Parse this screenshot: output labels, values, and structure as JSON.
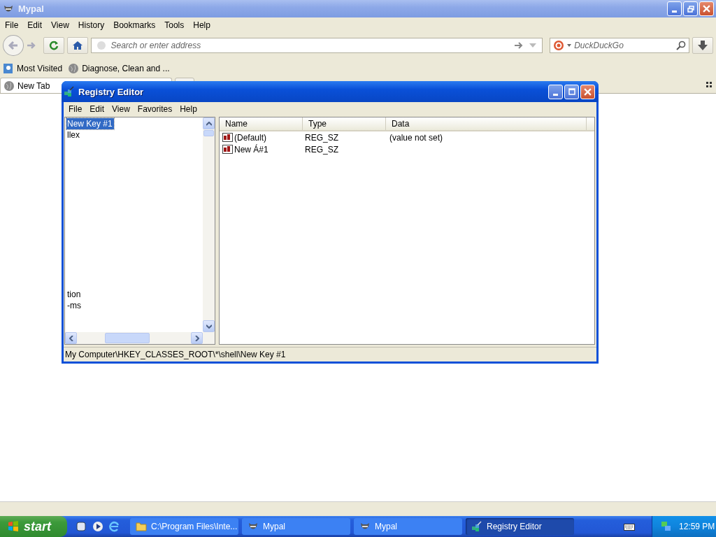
{
  "browser": {
    "title": "Mypal",
    "menu": [
      "File",
      "Edit",
      "View",
      "History",
      "Bookmarks",
      "Tools",
      "Help"
    ],
    "address": {
      "placeholder": "Search or enter address"
    },
    "search": {
      "placeholder": "DuckDuckGo"
    },
    "bookmarks": [
      {
        "label": "Most Visited",
        "kind": "folder"
      },
      {
        "label": "Diagnose, Clean and ...",
        "kind": "page"
      }
    ],
    "tabs": [
      {
        "label": "New Tab",
        "selected": true
      }
    ]
  },
  "registry_editor": {
    "title": "Registry Editor",
    "menu": [
      "File",
      "Edit",
      "View",
      "Favorites",
      "Help"
    ],
    "tree": {
      "items_top": [
        {
          "label": "New Key #1",
          "selected": true
        },
        {
          "label": "llex",
          "selected": false
        }
      ],
      "items_bottom": [
        {
          "label": "tion",
          "selected": false
        },
        {
          "label": "-ms",
          "selected": false
        }
      ]
    },
    "columns": [
      "Name",
      "Type",
      "Data"
    ],
    "values": [
      {
        "name": "(Default)",
        "type": "REG_SZ",
        "data": "(value not set)"
      },
      {
        "name": "New Á#1",
        "type": "REG_SZ"
      }
    ],
    "status_bar": "My Computer\\HKEY_CLASSES_ROOT\\*\\shell\\New Key #1"
  },
  "taskbar": {
    "start": "start",
    "tasks": [
      {
        "label": "C:\\Program Files\\Inte...",
        "kind": "folder",
        "selected": false
      },
      {
        "label": "Mypal",
        "kind": "browser",
        "selected": false
      },
      {
        "label": "Mypal",
        "kind": "browser",
        "selected": false
      },
      {
        "label": "Registry Editor",
        "kind": "registry",
        "selected": true
      }
    ],
    "clock": "12:59 PM"
  }
}
